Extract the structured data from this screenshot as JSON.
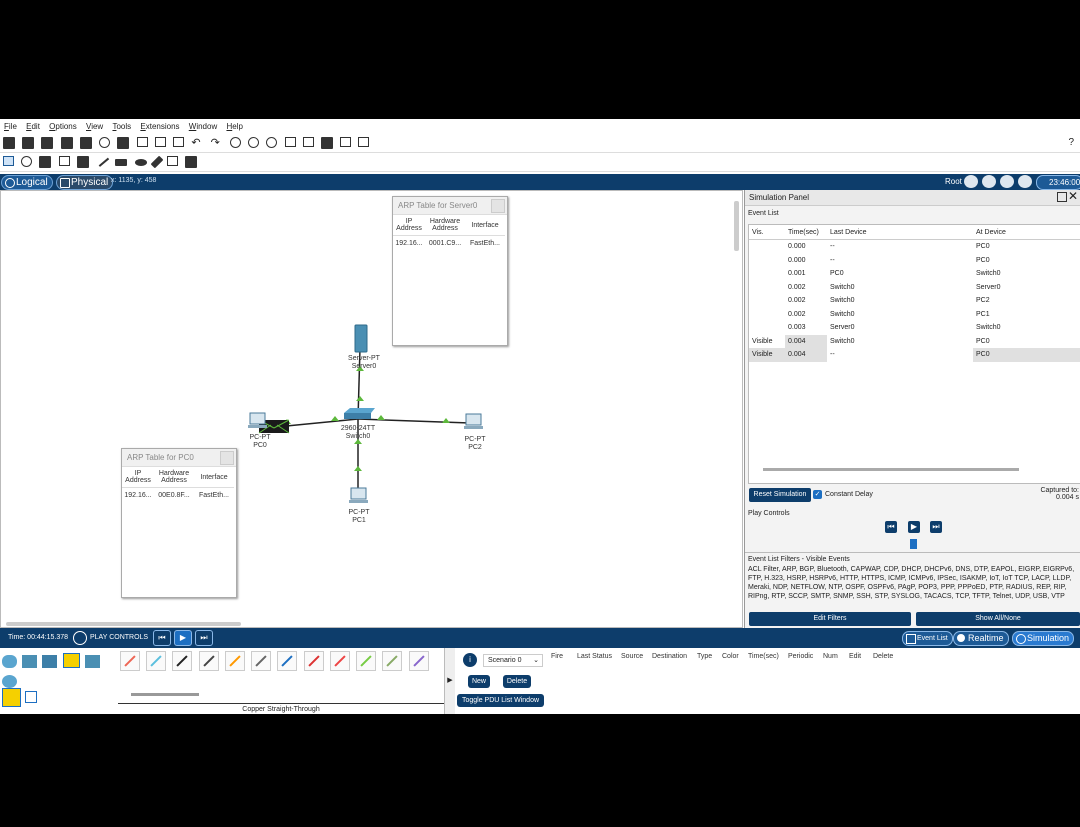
{
  "menu": [
    "File",
    "Edit",
    "Options",
    "View",
    "Tools",
    "Extensions",
    "Window",
    "Help"
  ],
  "help_mark": "?",
  "modes": {
    "logical": "Logical",
    "physical": "Physical",
    "coords": "x: 1135, y: 458",
    "root": "Root",
    "clock": "23:46:00"
  },
  "arp_server": {
    "title": "ARP Table for Server0",
    "headers": [
      "IP Address",
      "Hardware Address",
      "Interface"
    ],
    "row": [
      "192.16...",
      "0001.C9...",
      "FastEth..."
    ]
  },
  "arp_pc0": {
    "title": "ARP Table for PC0",
    "headers": [
      "IP Address",
      "Hardware Address",
      "Interface"
    ],
    "row": [
      "192.16...",
      "00E0.8F...",
      "FastEth..."
    ]
  },
  "devices": {
    "server": {
      "type": "Server-PT",
      "name": "Server0"
    },
    "switch": {
      "type": "2960-24TT",
      "name": "Switch0"
    },
    "pc0": {
      "type": "PC-PT",
      "name": "PC0"
    },
    "pc1": {
      "type": "PC-PT",
      "name": "PC1"
    },
    "pc2": {
      "type": "PC-PT",
      "name": "PC2"
    }
  },
  "sim": {
    "panel_title": "Simulation Panel",
    "event_list": "Event List",
    "columns": [
      "Vis.",
      "Time(sec)",
      "Last Device",
      "At Device"
    ],
    "events": [
      {
        "vis": "",
        "time": "0.000",
        "last": "--",
        "at": "PC0"
      },
      {
        "vis": "",
        "time": "0.000",
        "last": "--",
        "at": "PC0"
      },
      {
        "vis": "",
        "time": "0.001",
        "last": "PC0",
        "at": "Switch0"
      },
      {
        "vis": "",
        "time": "0.002",
        "last": "Switch0",
        "at": "Server0"
      },
      {
        "vis": "",
        "time": "0.002",
        "last": "Switch0",
        "at": "PC2"
      },
      {
        "vis": "",
        "time": "0.002",
        "last": "Switch0",
        "at": "PC1"
      },
      {
        "vis": "",
        "time": "0.003",
        "last": "Server0",
        "at": "Switch0"
      },
      {
        "vis": "Visible",
        "time": "0.004",
        "last": "Switch0",
        "at": "PC0"
      },
      {
        "vis": "Visible",
        "time": "0.004",
        "last": "--",
        "at": "PC0"
      }
    ],
    "reset": "Reset Simulation",
    "constant_delay": "Constant Delay",
    "captured_label": "Captured to:",
    "captured_value": "0.004 s",
    "play_controls": "Play Controls",
    "filters_title": "Event List Filters - Visible Events",
    "filters_text": "ACL Filter, ARP, BGP, Bluetooth, CAPWAP, CDP, DHCP, DHCPv6, DNS, DTP, EAPOL, EIGRP, EIGRPv6, FTP, H.323, HSRP, HSRPv6, HTTP, HTTPS, ICMP, ICMPv6, IPSec, ISAKMP, IoT, IoT TCP, LACP, LLDP, Meraki, NDP, NETFLOW, NTP, OSPF, OSPFv6, PAgP, POP3, PPP, PPPoED, PTP, RADIUS, REP, RIP, RIPng, RTP, SCCP, SMTP, SNMP, SSH, STP, SYSLOG, TACACS, TCP, TFTP, Telnet, UDP, USB, VTP",
    "edit_filters": "Edit Filters",
    "show_all": "Show All/None"
  },
  "bottom": {
    "time": "Time: 00:44:15.378",
    "play_controls": "PLAY CONTROLS",
    "event_list": "Event List",
    "realtime": "Realtime",
    "simulation": "Simulation",
    "cable_name": "Copper Straight-Through",
    "scenario": "Scenario 0",
    "new": "New",
    "delete": "Delete",
    "toggle_pdu": "Toggle PDU List Window",
    "pdu_columns": [
      "Fire",
      "Last Status",
      "Source",
      "Destination",
      "Type",
      "Color",
      "Time(sec)",
      "Periodic",
      "Num",
      "Edit",
      "Delete"
    ]
  }
}
